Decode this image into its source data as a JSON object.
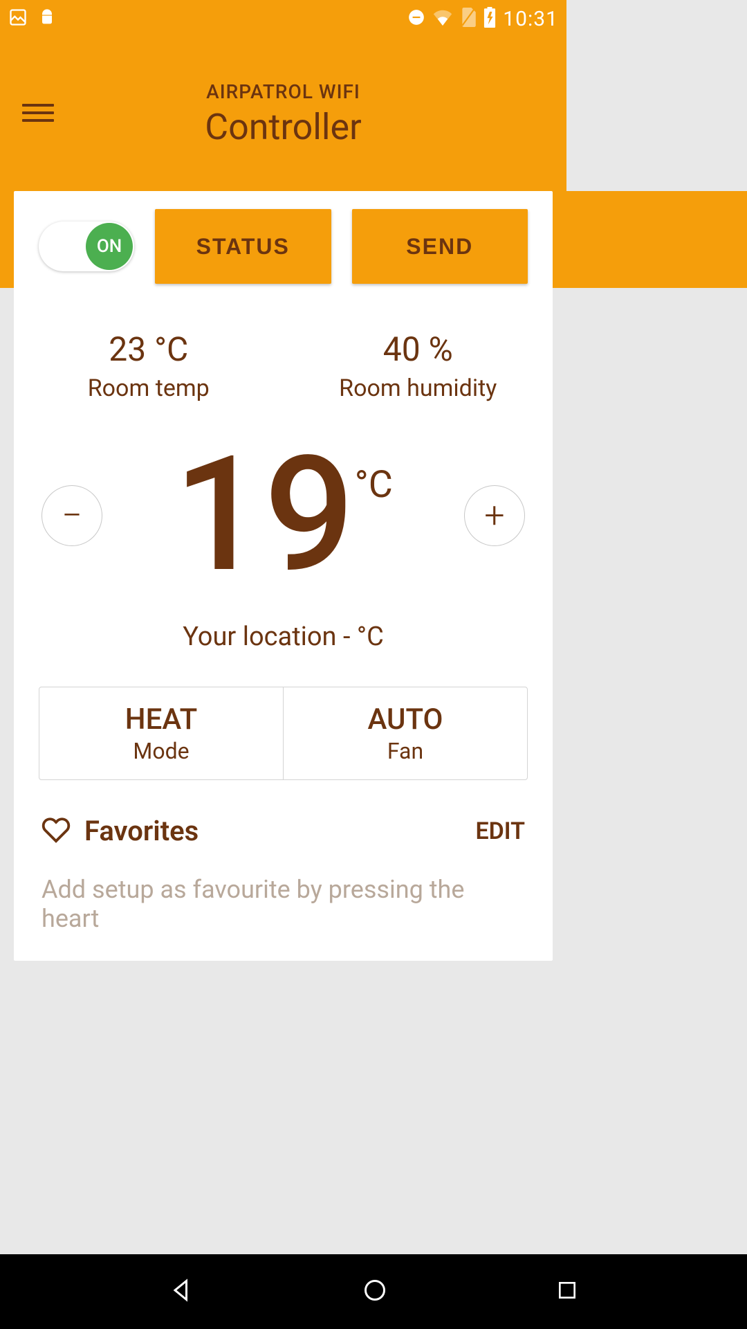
{
  "statusBar": {
    "time": "10:31"
  },
  "header": {
    "subtitle": "AIRPATROL WIFI",
    "title": "Controller"
  },
  "toggle": {
    "label": "ON"
  },
  "buttons": {
    "status": "STATUS",
    "send": "SEND"
  },
  "stats": {
    "temp": {
      "value": "23 °C",
      "label": "Room temp"
    },
    "humidity": {
      "value": "40 %",
      "label": "Room humidity"
    }
  },
  "setpoint": {
    "value": "19",
    "unit": "°C"
  },
  "location": {
    "text": "Your location - °C"
  },
  "mode": {
    "value": "HEAT",
    "label": "Mode"
  },
  "fan": {
    "value": "AUTO",
    "label": "Fan"
  },
  "favorites": {
    "title": "Favorites",
    "edit": "EDIT",
    "hint": "Add setup as favourite by pressing the heart"
  }
}
